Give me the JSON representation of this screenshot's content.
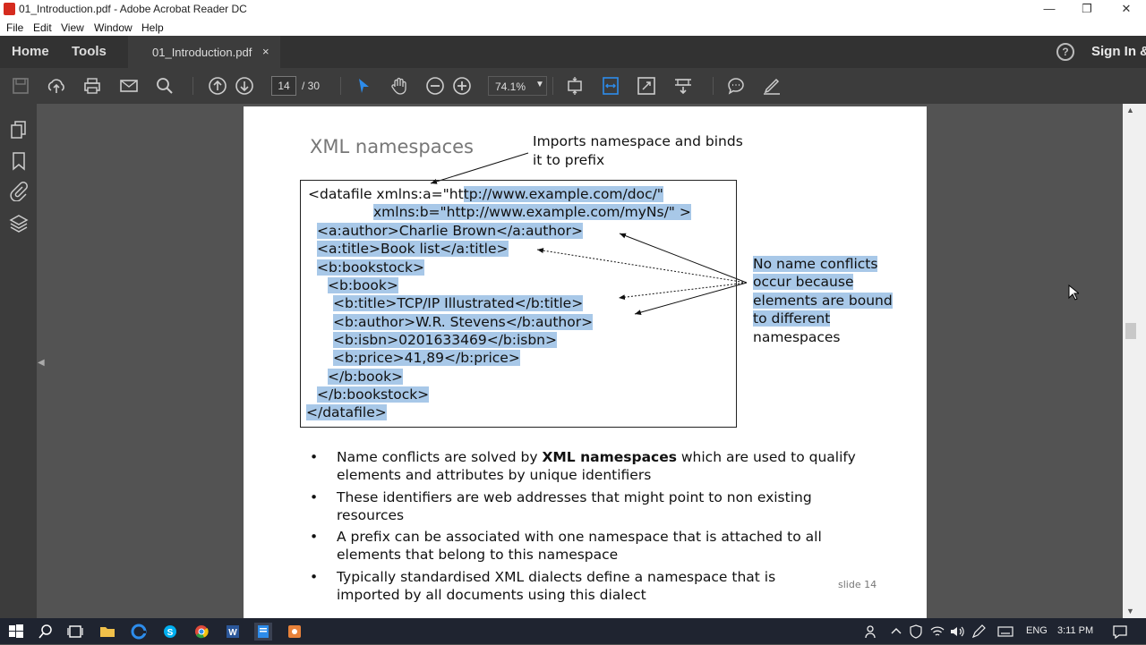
{
  "window": {
    "title": "01_Introduction.pdf - Adobe Acrobat Reader DC"
  },
  "menu": [
    "File",
    "Edit",
    "View",
    "Window",
    "Help"
  ],
  "tabs": {
    "home": "Home",
    "tools": "Tools",
    "document": "01_Introduction.pdf",
    "close": "×",
    "help": "?",
    "signin": "Sign In &"
  },
  "toolbar": {
    "page_current": "14",
    "page_total": "/ 30",
    "zoom": "74.1%",
    "icons": [
      "save-icon",
      "upload-icon",
      "print-icon",
      "email-icon",
      "search-icon",
      "prev-page-icon",
      "next-page-icon",
      "select-arrow-icon",
      "hand-icon",
      "zoom-out-icon",
      "zoom-in-icon",
      "fit-page-icon",
      "fit-width-icon",
      "fullscreen-icon",
      "scroll-mode-icon",
      "comment-icon",
      "highlight-pen-icon"
    ]
  },
  "slide": {
    "title": "XML namespaces",
    "note_top_1": "Imports namespace and binds",
    "note_top_2": "it to prefix",
    "note_right": [
      "No name conflicts",
      "occur because",
      "elements are bound",
      "to different",
      "namespaces"
    ],
    "code_first_plain": "<datafile xmlns:a=\"ht",
    "code_first_hl": "tp://www.example.com/doc/\"",
    "code_lines": [
      "xmlns:b=\"http://www.example.com/myNs/\" >",
      "<a:author>Charlie Brown</a:author>",
      "<a:title>Book list</a:title>",
      "<b:bookstock>",
      "<b:book>",
      "<b:title>TCP/IP Illustrated</b:title>",
      "<b:author>W.R. Stevens</b:author>",
      "<b:isbn>0201633469</b:isbn>",
      "<b:price>41,89</b:price>",
      "</b:book>",
      "</b:bookstock>",
      "</datafile>"
    ],
    "bullet_mark": "•",
    "bullet1_pre": "Name conflicts are solved by ",
    "bullet1_bold": "XML namespaces",
    "bullet1_post": " which are used to qualify elements and attributes by unique identifiers",
    "bullet2": "These identifiers are web addresses that might point to non existing resources",
    "bullet3": "A prefix can be associated with one namespace that is attached to all elements that belong to this namespace",
    "bullet4": "Typically standardised XML dialects define a namespace that is imported by all documents using this dialect",
    "slide_number": "slide 14"
  },
  "taskbar": {
    "lang": "ENG",
    "time": "3:11 PM"
  },
  "colors": {
    "selection": "#a8c8e8",
    "acrobat_red": "#d52b1e",
    "toolbar_bg": "#3c3c3c",
    "accent_blue": "#2d8ceb"
  }
}
